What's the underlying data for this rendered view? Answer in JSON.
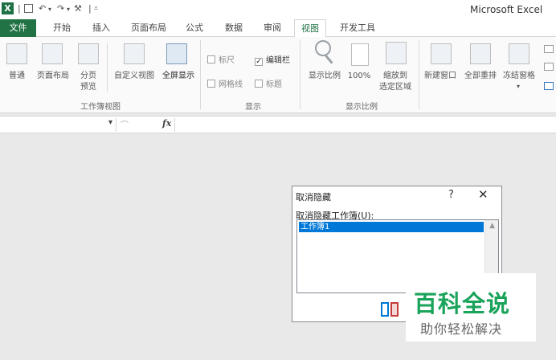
{
  "titlebar": {
    "app_title": "Microsoft Excel",
    "excel_logo": "X",
    "qat_icons": [
      "save-icon",
      "undo-icon",
      "redo-icon",
      "spell-icon",
      "customize-qat-icon"
    ]
  },
  "tabs": [
    {
      "label": "文件",
      "state": "file"
    },
    {
      "label": "开始"
    },
    {
      "label": "插入"
    },
    {
      "label": "页面布局"
    },
    {
      "label": "公式"
    },
    {
      "label": "数据"
    },
    {
      "label": "审阅"
    },
    {
      "label": "视图",
      "state": "active"
    },
    {
      "label": "开发工具"
    }
  ],
  "ribbon": {
    "workbook_views": {
      "group_label": "工作簿视图",
      "normal": "普通",
      "page_layout": "页面布局",
      "page_break_line1": "分页",
      "page_break_line2": "预览",
      "custom_views": "自定义视图",
      "full_screen": "全屏显示"
    },
    "show": {
      "group_label": "显示",
      "ruler": "标尺",
      "formula_bar": "编辑栏",
      "gridlines": "网格线",
      "headings": "标题",
      "formula_bar_checked": "✓"
    },
    "zoom": {
      "group_label": "显示比例",
      "zoom": "显示比例",
      "zoom_100": "100%",
      "zoom_selection_line1": "缩放到",
      "zoom_selection_line2": "选定区域"
    },
    "window": {
      "new_window": "新建窗口",
      "arrange_all": "全部重排",
      "freeze_panes": "冻结窗格",
      "freeze_arrow": "▾"
    }
  },
  "formula_bar": {
    "namebox_arrow": "▾",
    "fx": "fx",
    "cancel_glyph": "⌒"
  },
  "dialog": {
    "title": "取消隐藏",
    "help": "?",
    "close": "✕",
    "label": "取消隐藏工作簿(U):",
    "items": [
      "工作簿1"
    ],
    "scroll_up": "▲"
  },
  "watermark": {
    "main": "百科全说",
    "sub": "助你轻松解决"
  },
  "colors": {
    "excel_green": "#217346",
    "selection_blue": "#0078d7",
    "watermark_green": "#1aa35a"
  }
}
